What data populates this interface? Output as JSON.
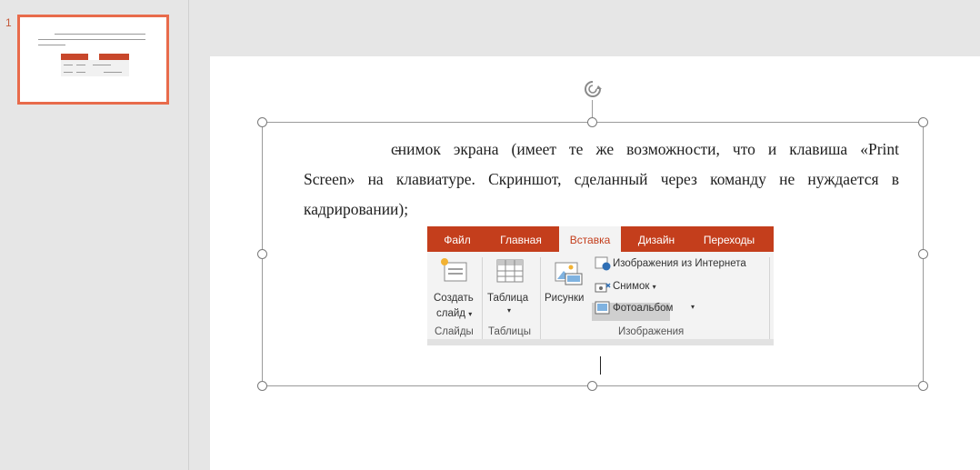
{
  "thumbnails": [
    {
      "number": "1"
    }
  ],
  "slide": {
    "line1_dash": "-",
    "line1": "снимок экрана (имеет те же возможности, что и клавиша «Print",
    "line2": "Screen» на клавиатуре. Скриншот, сделанный через команду не нуждается в",
    "line3": "кадрировании);"
  },
  "ribbon": {
    "tabs": [
      "Файл",
      "Главная",
      "Вставка",
      "Дизайн",
      "Переходы"
    ],
    "active_tab": "Вставка",
    "create_slide": [
      "Создать",
      "слайд"
    ],
    "table": "Таблица",
    "pictures": "Рисунки",
    "online_pictures": "Изображения из Интернета",
    "screenshot": "Снимок",
    "photo_album": "Фотоальбом",
    "groups": {
      "slides": "Слайды",
      "tables": "Таблицы",
      "images": "Изображения"
    },
    "colors": {
      "tab_bar": "#c43e1c",
      "ribbon_bg": "#f3f3f3"
    }
  },
  "colors": {
    "thumbnail_selection": "#e86b4b"
  }
}
